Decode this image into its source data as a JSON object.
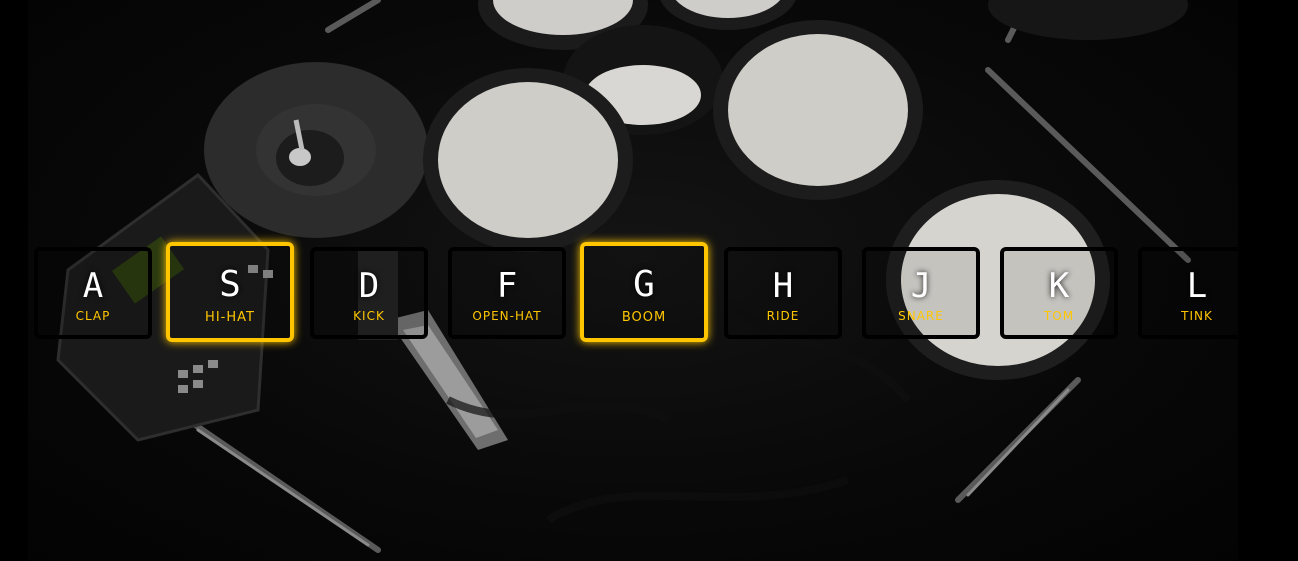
{
  "colors": {
    "accent": "#ffc600",
    "background": "#000000",
    "letter": "#ffffff"
  },
  "keys": [
    {
      "letter": "A",
      "sound": "CLAP",
      "playing": false
    },
    {
      "letter": "S",
      "sound": "HI-HAT",
      "playing": true
    },
    {
      "letter": "D",
      "sound": "KICK",
      "playing": false
    },
    {
      "letter": "F",
      "sound": "OPEN-HAT",
      "playing": false
    },
    {
      "letter": "G",
      "sound": "BOOM",
      "playing": true
    },
    {
      "letter": "H",
      "sound": "RIDE",
      "playing": false
    },
    {
      "letter": "J",
      "sound": "SNARE",
      "playing": false
    },
    {
      "letter": "K",
      "sound": "TOM",
      "playing": false
    },
    {
      "letter": "L",
      "sound": "TINK",
      "playing": false
    }
  ]
}
